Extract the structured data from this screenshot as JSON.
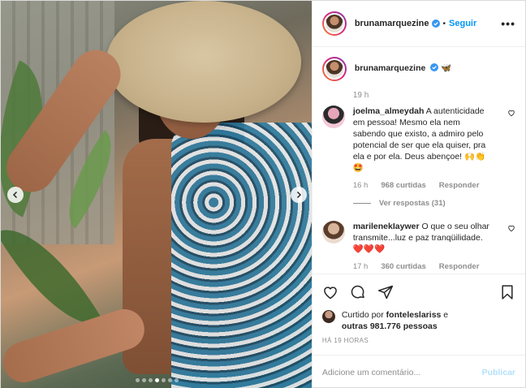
{
  "photo": {
    "alt_icon": "carousel-photo",
    "dots_total": 7,
    "dot_active_index": 3
  },
  "header": {
    "username": "brunamarquezine",
    "separator": "•",
    "follow_label": "Seguir",
    "more_label": "•••"
  },
  "caption": {
    "username": "brunamarquezine",
    "emoji": "🦋",
    "time": "19 h"
  },
  "comments": [
    {
      "username": "joelma_almeydah",
      "text": "A autenticidade em pessoa! Mesmo ela nem sabendo que existo, a admiro pelo potencial de ser que ela quiser, pra ela e por ela. Deus abençoe! 🙌👏🤩",
      "time": "16 h",
      "likes": "968 curtidas",
      "reply": "Responder",
      "view_replies": "Ver respostas (31)"
    },
    {
      "username": "marilenekIaywer",
      "text": "O que o seu olhar transmite...luz e paz tranqüilidade. ❤️❤️❤️",
      "time": "17 h",
      "likes": "360 curtidas",
      "reply": "Responder"
    }
  ],
  "likes_summary": {
    "prefix": "Curtido por ",
    "user": "fonteleslariss",
    "middle": " e ",
    "others": "outras 981.776 pessoas"
  },
  "post_time": "HÁ 19 HORAS",
  "add_comment": {
    "placeholder": "Adicione um comentário...",
    "publish_label": "Publicar"
  },
  "colors": {
    "accent": "#0095f6",
    "muted": "#8e8e8e",
    "publish_disabled": "#b2dffc"
  }
}
